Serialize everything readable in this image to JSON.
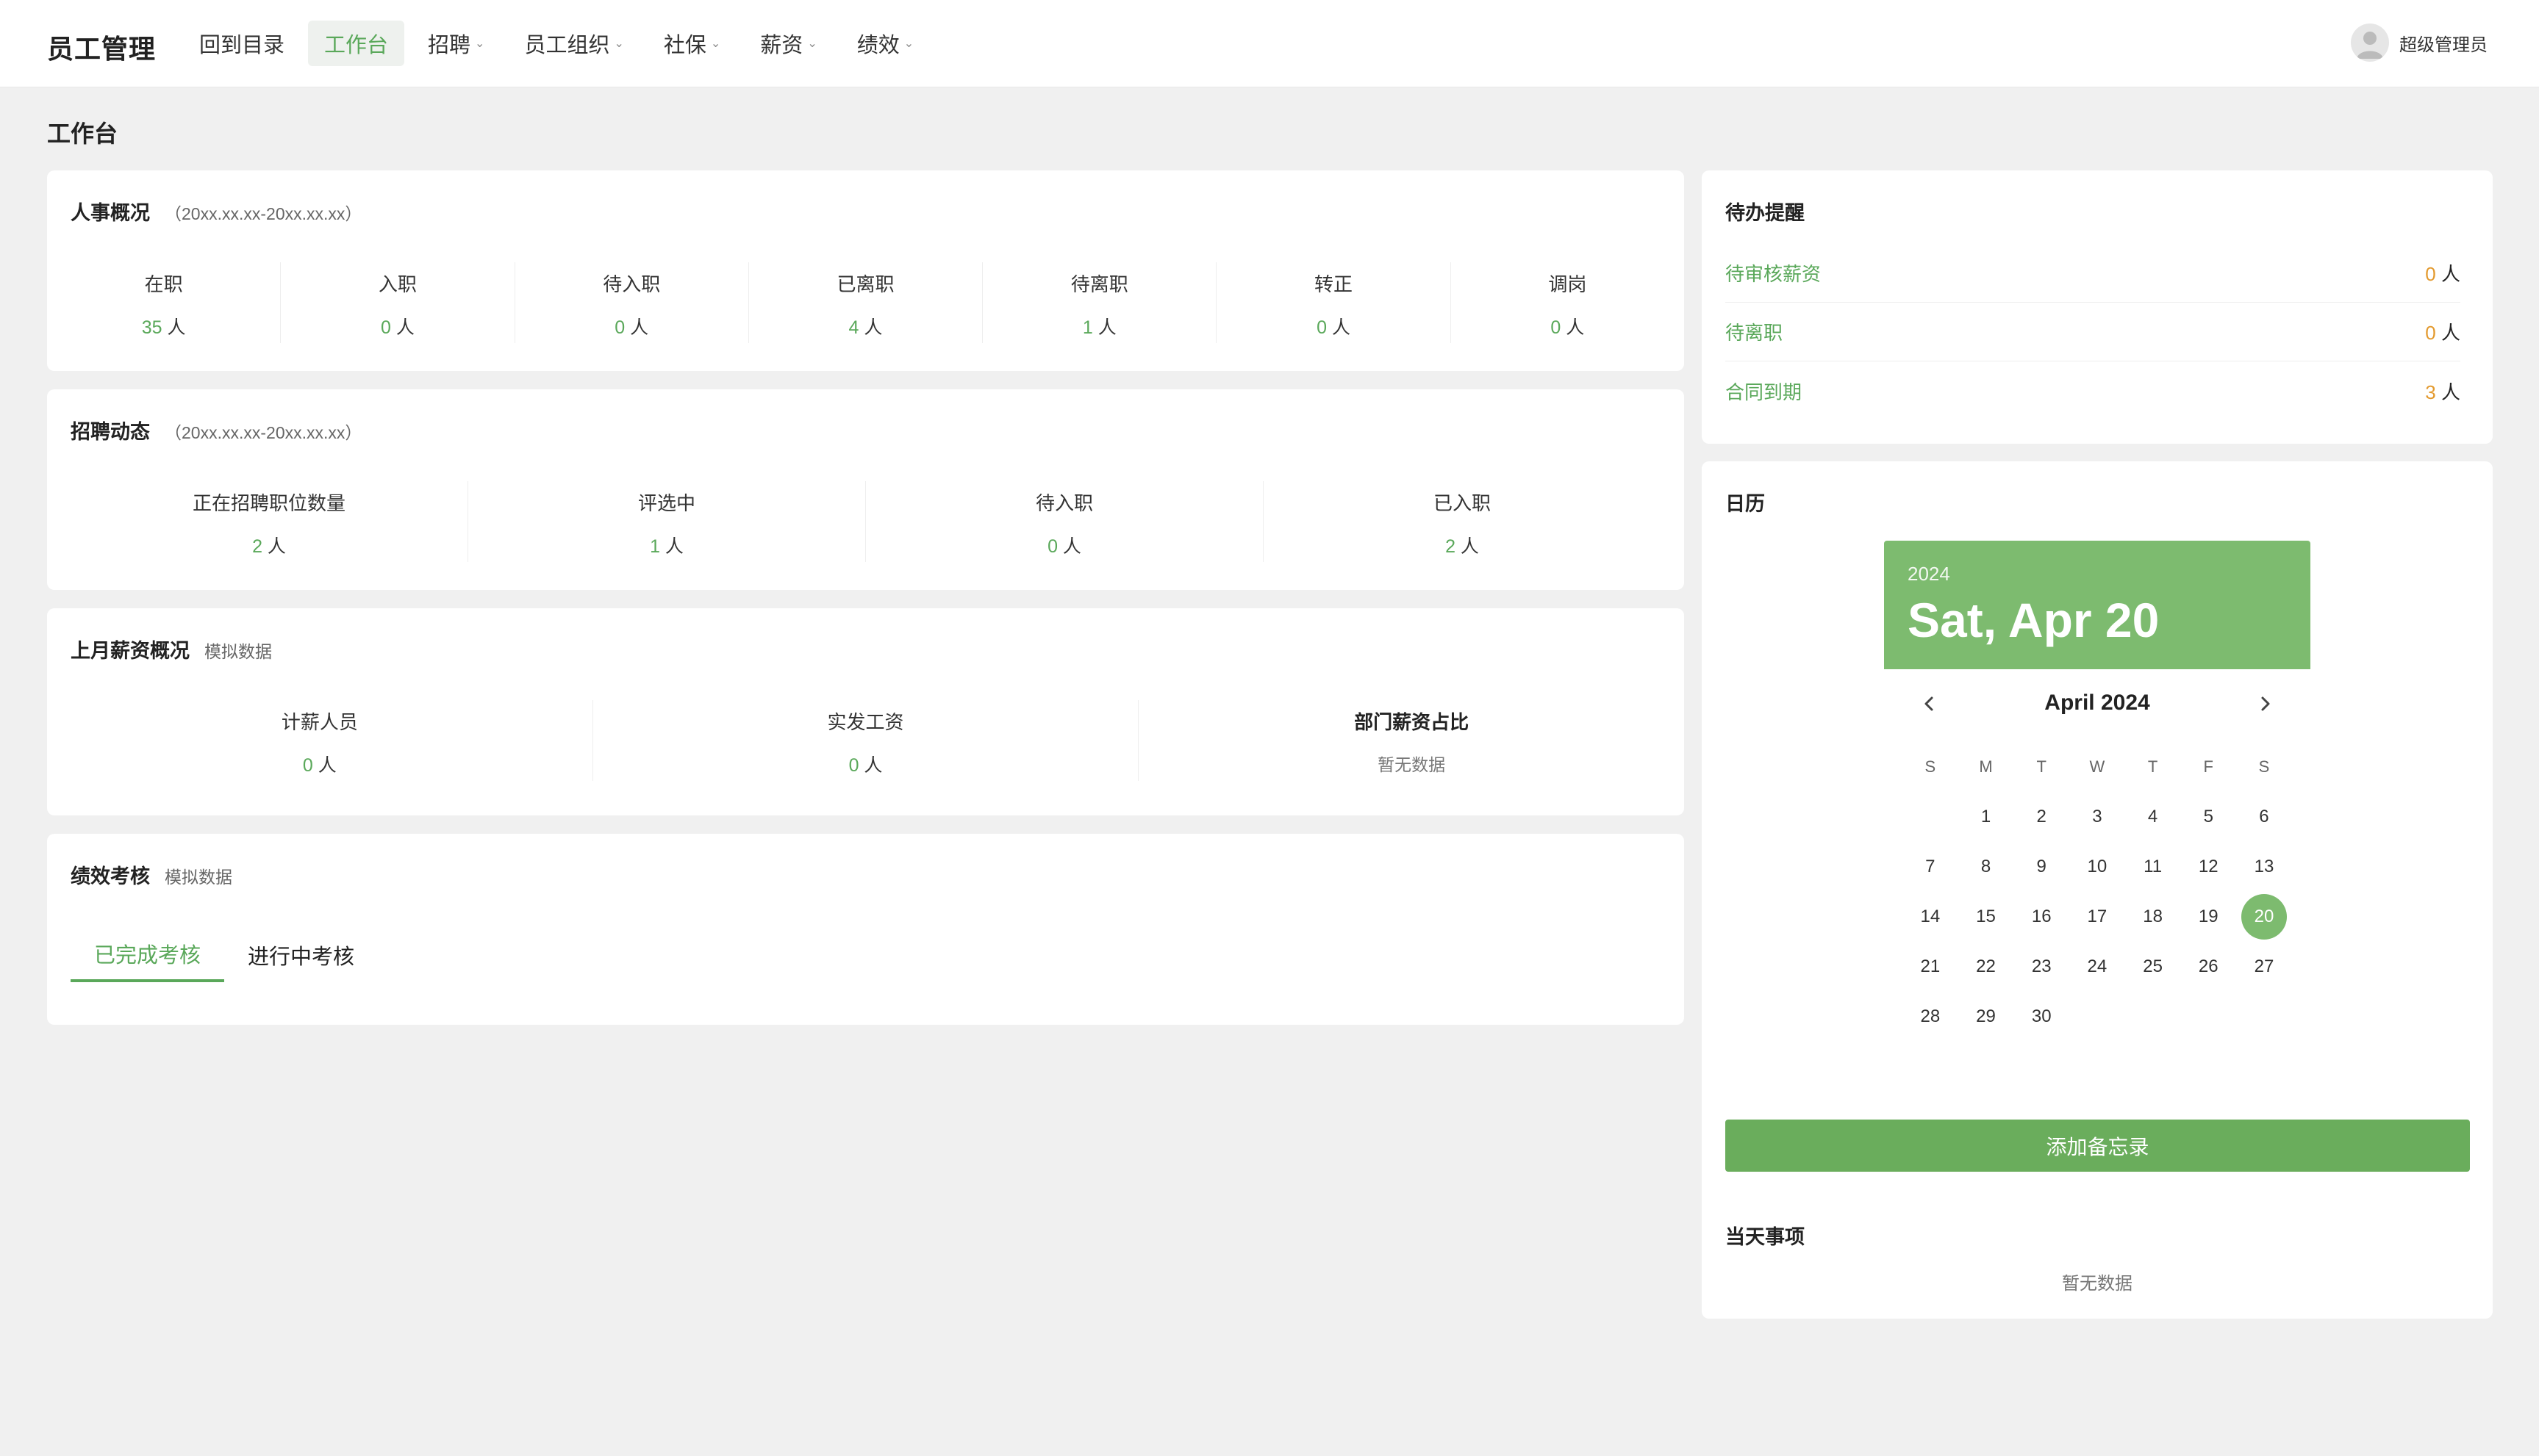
{
  "app": {
    "title": "员工管理"
  },
  "nav": {
    "items": [
      {
        "label": "回到目录",
        "has_caret": false
      },
      {
        "label": "工作台",
        "has_caret": false,
        "active": true
      },
      {
        "label": "招聘",
        "has_caret": true
      },
      {
        "label": "员工组织",
        "has_caret": true
      },
      {
        "label": "社保",
        "has_caret": true
      },
      {
        "label": "薪资",
        "has_caret": true
      },
      {
        "label": "绩效",
        "has_caret": true
      }
    ],
    "caret": "⌄"
  },
  "user": {
    "name": "超级管理员",
    "icon": "user-avatar-icon"
  },
  "page": {
    "title": "工作台"
  },
  "hr_overview": {
    "title": "人事概况",
    "range": "（20xx.xx.xx-20xx.xx.xx）",
    "unit": "人",
    "stats": [
      {
        "label": "在职",
        "value": "35"
      },
      {
        "label": "入职",
        "value": "0"
      },
      {
        "label": "待入职",
        "value": "0"
      },
      {
        "label": "已离职",
        "value": "4"
      },
      {
        "label": "待离职",
        "value": "1"
      },
      {
        "label": "转正",
        "value": "0"
      },
      {
        "label": "调岗",
        "value": "0"
      }
    ]
  },
  "recruit": {
    "title": "招聘动态",
    "range": "（20xx.xx.xx-20xx.xx.xx）",
    "unit": "人",
    "stats": [
      {
        "label": "正在招聘职位数量",
        "value": "2"
      },
      {
        "label": "评选中",
        "value": "1"
      },
      {
        "label": "待入职",
        "value": "0"
      },
      {
        "label": "已入职",
        "value": "2"
      }
    ]
  },
  "salary": {
    "title": "上月薪资概况",
    "tag": "模拟数据",
    "unit": "人",
    "stats": [
      {
        "label": "计薪人员",
        "value": "0"
      },
      {
        "label": "实发工资",
        "value": "0"
      }
    ],
    "dept_ratio": {
      "label": "部门薪资占比",
      "empty": "暂无数据"
    }
  },
  "performance": {
    "title": "绩效考核",
    "tag": "模拟数据",
    "tabs": [
      {
        "label": "已完成考核",
        "active": true
      },
      {
        "label": "进行中考核",
        "active": false
      }
    ]
  },
  "todo": {
    "title": "待办提醒",
    "unit": "人",
    "items": [
      {
        "label": "待审核薪资",
        "value": "0"
      },
      {
        "label": "待离职",
        "value": "0"
      },
      {
        "label": "合同到期",
        "value": "3"
      }
    ]
  },
  "calendar": {
    "title": "日历",
    "year": "2024",
    "date_display": "Sat, Apr 20",
    "month_label": "April 2024",
    "weekdays": [
      "S",
      "M",
      "T",
      "W",
      "T",
      "F",
      "S"
    ],
    "first_weekday_offset": 1,
    "days_in_month": 30,
    "selected_day": 20,
    "prev_icon": "chevron-left-icon",
    "next_icon": "chevron-right-icon"
  },
  "memo": {
    "button_label": "添加备忘录"
  },
  "today": {
    "title": "当天事项",
    "empty": "暂无数据"
  },
  "colors": {
    "accent": "#5aa85a",
    "calendar_header": "#7dbb6f",
    "button": "#6aad5c",
    "orange": "#e39a2f"
  }
}
